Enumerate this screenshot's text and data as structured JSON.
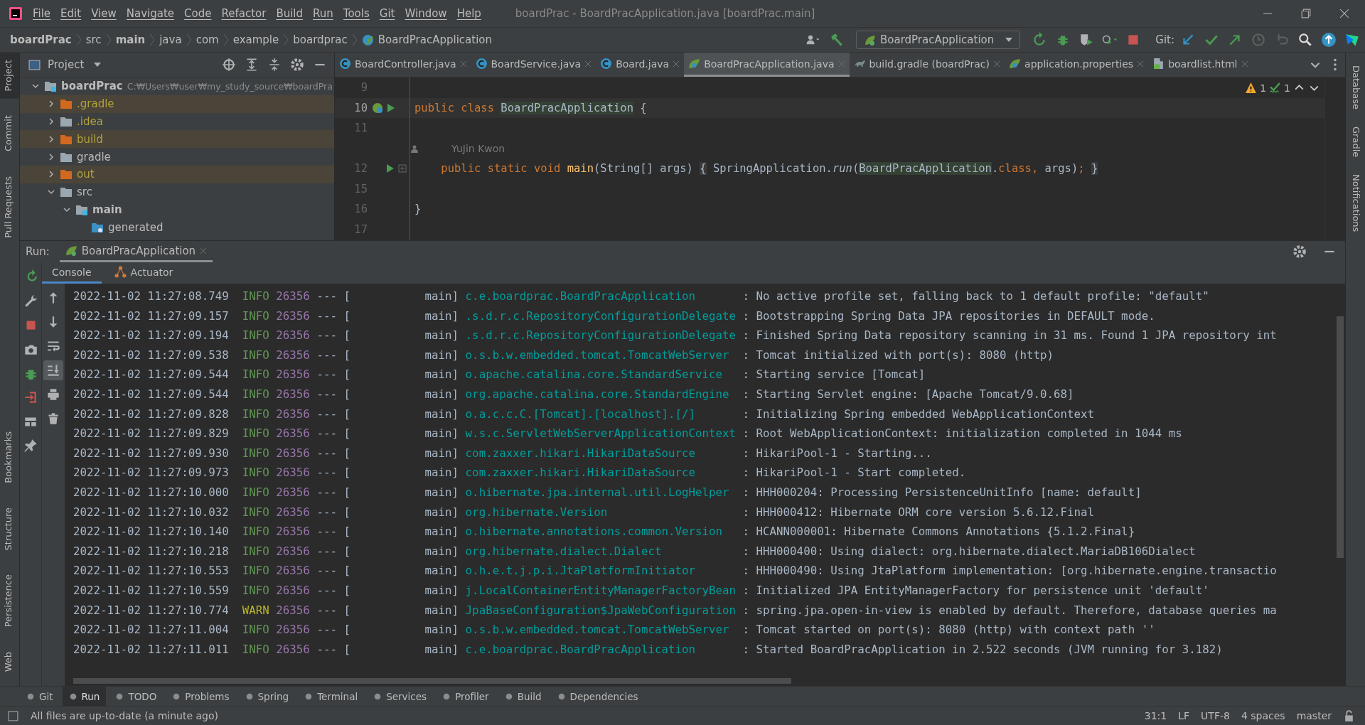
{
  "window": {
    "title": "boardPrac - BoardPracApplication.java [boardPrac.main]"
  },
  "menu": [
    "File",
    "Edit",
    "View",
    "Navigate",
    "Code",
    "Refactor",
    "Build",
    "Run",
    "Tools",
    "Git",
    "Window",
    "Help"
  ],
  "breadcrumbs": [
    {
      "text": "boardPrac",
      "bold": true
    },
    {
      "text": "src",
      "bold": false
    },
    {
      "text": "main",
      "bold": true
    },
    {
      "text": "java",
      "bold": false
    },
    {
      "text": "com",
      "bold": false
    },
    {
      "text": "example",
      "bold": false
    },
    {
      "text": "boardprac",
      "bold": false
    },
    {
      "text": "BoardPracApplication",
      "bold": false
    }
  ],
  "toolbar": {
    "run_config": "BoardPracApplication",
    "git_label": "Git:"
  },
  "left_stripe_top": [
    {
      "label": "Project",
      "selected": true
    },
    {
      "label": "Commit",
      "selected": false
    },
    {
      "label": "Pull Requests",
      "selected": false
    }
  ],
  "left_stripe_bottom": [
    {
      "label": "Bookmarks",
      "selected": false
    },
    {
      "label": "Structure",
      "selected": false
    },
    {
      "label": "Persistence",
      "selected": false
    },
    {
      "label": "Web",
      "selected": false
    }
  ],
  "right_stripe": [
    "Database",
    "Gradle",
    "Notifications"
  ],
  "project": {
    "title": "Project",
    "tree": [
      {
        "label": "boardPrac",
        "kind": "module",
        "path": "C:₩Users₩user₩my_study_source₩boardPra",
        "expanded": true,
        "children": [
          {
            "label": ".gradle",
            "kind": "folder",
            "ignored": true,
            "excluded": true,
            "expanded": false
          },
          {
            "label": ".idea",
            "kind": "folder",
            "ignored": true,
            "excluded": false,
            "expanded": false
          },
          {
            "label": "build",
            "kind": "folder",
            "ignored": true,
            "excluded": true,
            "expanded": false
          },
          {
            "label": "gradle",
            "kind": "folder",
            "ignored": false,
            "excluded": false,
            "expanded": false
          },
          {
            "label": "out",
            "kind": "folder",
            "ignored": true,
            "excluded": true,
            "expanded": false
          },
          {
            "label": "src",
            "kind": "folder",
            "ignored": false,
            "excluded": false,
            "expanded": true,
            "children": [
              {
                "label": "main",
                "kind": "module",
                "expanded": true,
                "children": [
                  {
                    "label": "generated",
                    "kind": "generated"
                  }
                ]
              }
            ]
          }
        ]
      }
    ]
  },
  "editor_tabs": [
    {
      "label": "BoardController.java",
      "kind": "class",
      "selected": false
    },
    {
      "label": "BoardService.java",
      "kind": "class",
      "selected": false
    },
    {
      "label": "Board.java",
      "kind": "class",
      "selected": false
    },
    {
      "label": "BoardPracApplication.java",
      "kind": "spring",
      "selected": true
    },
    {
      "label": "build.gradle (boardPrac)",
      "kind": "gradle",
      "selected": false
    },
    {
      "label": "application.properties",
      "kind": "spring",
      "selected": false
    },
    {
      "label": "boardlist.html",
      "kind": "html",
      "selected": false
    }
  ],
  "inspections": {
    "warnings": "1",
    "typos": "1"
  },
  "code": [
    {
      "kind": "code",
      "number": "9"
    },
    {
      "kind": "code",
      "number": "10",
      "current": true,
      "bean": true,
      "run": true,
      "tokens": [
        {
          "text": "public class ",
          "kind": "keyword"
        },
        {
          "text": "BoardPracApplication",
          "kind": "highlight"
        },
        {
          "text": " {",
          "kind": "plain"
        }
      ]
    },
    {
      "kind": "code",
      "number": "11"
    },
    {
      "kind": "hint",
      "text": "YuJin Kwon"
    },
    {
      "kind": "code",
      "number": "12",
      "run": true,
      "fold": true,
      "tokens": [
        {
          "text": "    public static void ",
          "kind": "keyword"
        },
        {
          "text": "main",
          "kind": "method"
        },
        {
          "text": "(String[] args) ",
          "kind": "plain"
        },
        {
          "text": "{",
          "kind": "fold"
        },
        {
          "text": " SpringApplication.",
          "kind": "plain"
        },
        {
          "text": "run",
          "kind": "italic"
        },
        {
          "text": "(",
          "kind": "plain"
        },
        {
          "text": "BoardPracApplication",
          "kind": "highlight"
        },
        {
          "text": ".",
          "kind": "plain"
        },
        {
          "text": "class, ",
          "kind": "keyword"
        },
        {
          "text": "args)",
          "kind": "plain"
        },
        {
          "text": ";",
          "kind": "keyword"
        },
        {
          "text": "}",
          "kind": "fold"
        }
      ]
    },
    {
      "kind": "code",
      "number": "15"
    },
    {
      "kind": "code",
      "number": "16",
      "tokens": [
        {
          "text": "}",
          "kind": "plain"
        }
      ]
    },
    {
      "kind": "code",
      "number": "17"
    }
  ],
  "run": {
    "label": "Run:",
    "tab": "BoardPracApplication",
    "subtabs": [
      {
        "label": "Console",
        "selected": true
      },
      {
        "label": "Actuator",
        "selected": false
      }
    ]
  },
  "log": [
    {
      "time": "2022-11-02 11:27:08.749",
      "level": "INFO",
      "pid": "26356",
      "thread": "--- [           main]",
      "logger": "c.e.boardprac.BoardPracApplication      ",
      "message": ": No active profile set, falling back to 1 default profile: \"default\""
    },
    {
      "time": "2022-11-02 11:27:09.157",
      "level": "INFO",
      "pid": "26356",
      "thread": "--- [           main]",
      "logger": ".s.d.r.c.RepositoryConfigurationDelegate",
      "message": ": Bootstrapping Spring Data JPA repositories in DEFAULT mode."
    },
    {
      "time": "2022-11-02 11:27:09.194",
      "level": "INFO",
      "pid": "26356",
      "thread": "--- [           main]",
      "logger": ".s.d.r.c.RepositoryConfigurationDelegate",
      "message": ": Finished Spring Data repository scanning in 31 ms. Found 1 JPA repository int"
    },
    {
      "time": "2022-11-02 11:27:09.538",
      "level": "INFO",
      "pid": "26356",
      "thread": "--- [           main]",
      "logger": "o.s.b.w.embedded.tomcat.TomcatWebServer ",
      "message": ": Tomcat initialized with port(s): 8080 (http)"
    },
    {
      "time": "2022-11-02 11:27:09.544",
      "level": "INFO",
      "pid": "26356",
      "thread": "--- [           main]",
      "logger": "o.apache.catalina.core.StandardService  ",
      "message": ": Starting service [Tomcat]"
    },
    {
      "time": "2022-11-02 11:27:09.544",
      "level": "INFO",
      "pid": "26356",
      "thread": "--- [           main]",
      "logger": "org.apache.catalina.core.StandardEngine ",
      "message": ": Starting Servlet engine: [Apache Tomcat/9.0.68]"
    },
    {
      "time": "2022-11-02 11:27:09.828",
      "level": "INFO",
      "pid": "26356",
      "thread": "--- [           main]",
      "logger": "o.a.c.c.C.[Tomcat].[localhost].[/]      ",
      "message": ": Initializing Spring embedded WebApplicationContext"
    },
    {
      "time": "2022-11-02 11:27:09.829",
      "level": "INFO",
      "pid": "26356",
      "thread": "--- [           main]",
      "logger": "w.s.c.ServletWebServerApplicationContext",
      "message": ": Root WebApplicationContext: initialization completed in 1044 ms"
    },
    {
      "time": "2022-11-02 11:27:09.930",
      "level": "INFO",
      "pid": "26356",
      "thread": "--- [           main]",
      "logger": "com.zaxxer.hikari.HikariDataSource      ",
      "message": ": HikariPool-1 - Starting..."
    },
    {
      "time": "2022-11-02 11:27:09.973",
      "level": "INFO",
      "pid": "26356",
      "thread": "--- [           main]",
      "logger": "com.zaxxer.hikari.HikariDataSource      ",
      "message": ": HikariPool-1 - Start completed."
    },
    {
      "time": "2022-11-02 11:27:10.000",
      "level": "INFO",
      "pid": "26356",
      "thread": "--- [           main]",
      "logger": "o.hibernate.jpa.internal.util.LogHelper ",
      "message": ": HHH000204: Processing PersistenceUnitInfo [name: default]"
    },
    {
      "time": "2022-11-02 11:27:10.032",
      "level": "INFO",
      "pid": "26356",
      "thread": "--- [           main]",
      "logger": "org.hibernate.Version                   ",
      "message": ": HHH000412: Hibernate ORM core version 5.6.12.Final"
    },
    {
      "time": "2022-11-02 11:27:10.140",
      "level": "INFO",
      "pid": "26356",
      "thread": "--- [           main]",
      "logger": "o.hibernate.annotations.common.Version  ",
      "message": ": HCANN000001: Hibernate Commons Annotations {5.1.2.Final}"
    },
    {
      "time": "2022-11-02 11:27:10.218",
      "level": "INFO",
      "pid": "26356",
      "thread": "--- [           main]",
      "logger": "org.hibernate.dialect.Dialect           ",
      "message": ": HHH000400: Using dialect: org.hibernate.dialect.MariaDB106Dialect"
    },
    {
      "time": "2022-11-02 11:27:10.553",
      "level": "INFO",
      "pid": "26356",
      "thread": "--- [           main]",
      "logger": "o.h.e.t.j.p.i.JtaPlatformInitiator      ",
      "message": ": HHH000490: Using JtaPlatform implementation: [org.hibernate.engine.transactio"
    },
    {
      "time": "2022-11-02 11:27:10.559",
      "level": "INFO",
      "pid": "26356",
      "thread": "--- [           main]",
      "logger": "j.LocalContainerEntityManagerFactoryBean",
      "message": ": Initialized JPA EntityManagerFactory for persistence unit 'default'"
    },
    {
      "time": "2022-11-02 11:27:10.774",
      "level": "WARN",
      "pid": "26356",
      "thread": "--- [           main]",
      "logger": "JpaBaseConfiguration$JpaWebConfiguration",
      "message": ": spring.jpa.open-in-view is enabled by default. Therefore, database queries ma"
    },
    {
      "time": "2022-11-02 11:27:11.004",
      "level": "INFO",
      "pid": "26356",
      "thread": "--- [           main]",
      "logger": "o.s.b.w.embedded.tomcat.TomcatWebServer ",
      "message": ": Tomcat started on port(s): 8080 (http) with context path ''"
    },
    {
      "time": "2022-11-02 11:27:11.011",
      "level": "INFO",
      "pid": "26356",
      "thread": "--- [           main]",
      "logger": "c.e.boardprac.BoardPracApplication      ",
      "message": ": Started BoardPracApplication in 2.522 seconds (JVM running for 3.182)"
    }
  ],
  "bottom_tools": [
    {
      "label": "Git",
      "selected": false
    },
    {
      "label": "Run",
      "selected": true
    },
    {
      "label": "TODO",
      "selected": false
    },
    {
      "label": "Problems",
      "selected": false
    },
    {
      "label": "Spring",
      "selected": false
    },
    {
      "label": "Terminal",
      "selected": false
    },
    {
      "label": "Services",
      "selected": false
    },
    {
      "label": "Profiler",
      "selected": false
    },
    {
      "label": "Build",
      "selected": false
    },
    {
      "label": "Dependencies",
      "selected": false
    }
  ],
  "status_bar": {
    "message": "All files are up-to-date (a minute ago)",
    "position": "31:1",
    "line_sep": "LF",
    "encoding": "UTF-8",
    "indent": "4 spaces",
    "branch": "master"
  }
}
